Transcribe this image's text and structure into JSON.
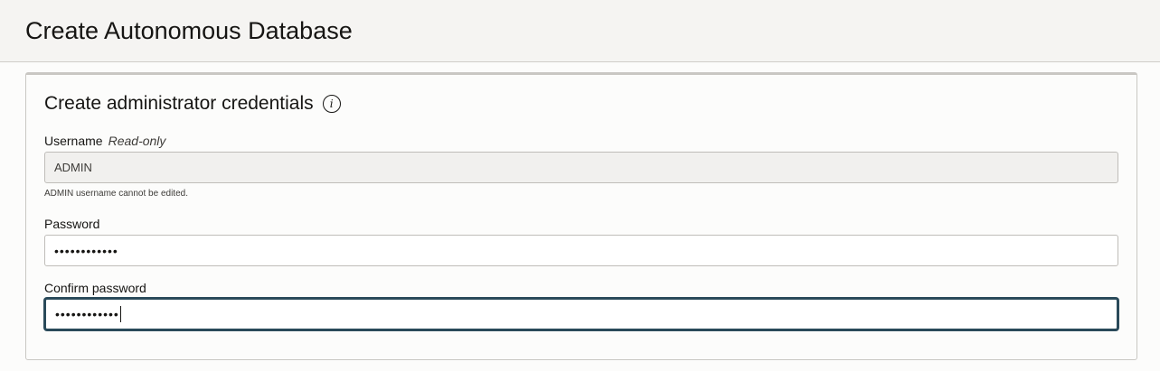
{
  "header": {
    "title": "Create Autonomous Database"
  },
  "credentials": {
    "section_title": "Create administrator credentials",
    "info_icon": "info-icon",
    "username": {
      "label": "Username",
      "readonly_tag": "Read-only",
      "value": "ADMIN",
      "help": "ADMIN username cannot be edited."
    },
    "password": {
      "label": "Password",
      "masked_value": "••••••••••••"
    },
    "confirm_password": {
      "label": "Confirm password",
      "masked_value": "••••••••••••"
    }
  },
  "colors": {
    "focus_border": "#2a4a5a",
    "header_bg": "#f5f4f2"
  }
}
